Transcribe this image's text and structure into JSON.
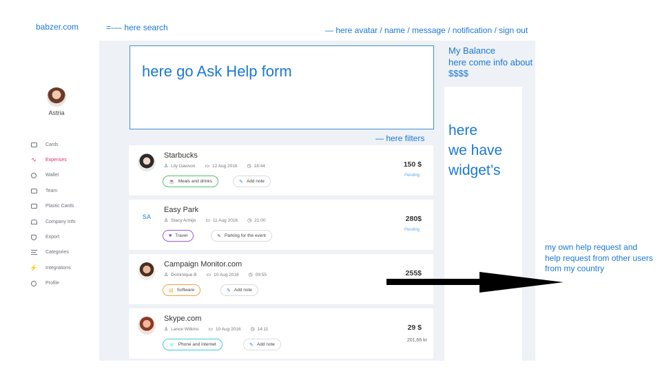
{
  "brand": "babzer.com",
  "annotations": {
    "search": "=-— here search",
    "header": "— here avatar / name / message / notification / sign out",
    "ask_form": "here go Ask Help form",
    "balance_title": "My Balance",
    "balance_line2": "here come info about",
    "balance_line3": "$$$$",
    "filters": "— here filters",
    "widget_line1": "here",
    "widget_line2": "we have",
    "widget_line3": "widget’s",
    "note_line1": "my own  help request and",
    "note_line2": "help request from other users",
    "note_line3": "from my  country"
  },
  "profile": {
    "name": "Astria"
  },
  "sidebar": {
    "items": [
      {
        "label": "Cards",
        "icon": "card-icon",
        "active": false
      },
      {
        "label": "Expenses",
        "icon": "pulse-icon",
        "active": true
      },
      {
        "label": "Wallet",
        "icon": "wallet-icon",
        "active": false
      },
      {
        "label": "Team",
        "icon": "team-icon",
        "active": false
      },
      {
        "label": "Plastic Cards",
        "icon": "plastic-card-icon",
        "active": false
      },
      {
        "label": "Company Info",
        "icon": "building-icon",
        "active": false
      },
      {
        "label": "Export",
        "icon": "export-icon",
        "active": false
      },
      {
        "label": "Categories",
        "icon": "list-icon",
        "active": false
      },
      {
        "label": "Integrations",
        "icon": "plug-icon",
        "active": false
      },
      {
        "label": "Profile",
        "icon": "profile-icon",
        "active": false
      }
    ]
  },
  "expenses": [
    {
      "merchant": "Starbucks",
      "user": "Lily Dawson",
      "date": "12 Aug 2016",
      "time": "18:44",
      "category": "Meals and drinks",
      "note": "Add note",
      "amount": "150 $",
      "status": "Pending",
      "sub_amount": ""
    },
    {
      "merchant": "Easy Park",
      "user": "Stacy Armijo",
      "date": "11 Aug 2016",
      "time": "21:00",
      "category": "Travel",
      "note": "Parking for the event",
      "amount": "280$",
      "status": "Pending",
      "sub_amount": "",
      "initials": "SA"
    },
    {
      "merchant": "Campaign Monitor.com",
      "user": "Dominique B",
      "date": "10 Aug 2016",
      "time": "09:55",
      "category": "Software",
      "note": "Add note",
      "amount": "255$",
      "status": "",
      "sub_amount": ""
    },
    {
      "merchant": "Skype.com",
      "user": "Lance Wilkins",
      "date": "10 Aug 2016",
      "time": "14:11",
      "category": "Phone and internet",
      "note": "Add note",
      "amount": "29 $",
      "status": "",
      "sub_amount": "201,66 kr"
    }
  ],
  "colors": {
    "annotation": "#1a78d6",
    "active_nav": "#e0306b",
    "meals": "#4cc36b",
    "travel": "#9b5ad6",
    "software": "#f0a23a",
    "phone": "#3ec8d8",
    "panel_bg": "#eef1f5"
  }
}
